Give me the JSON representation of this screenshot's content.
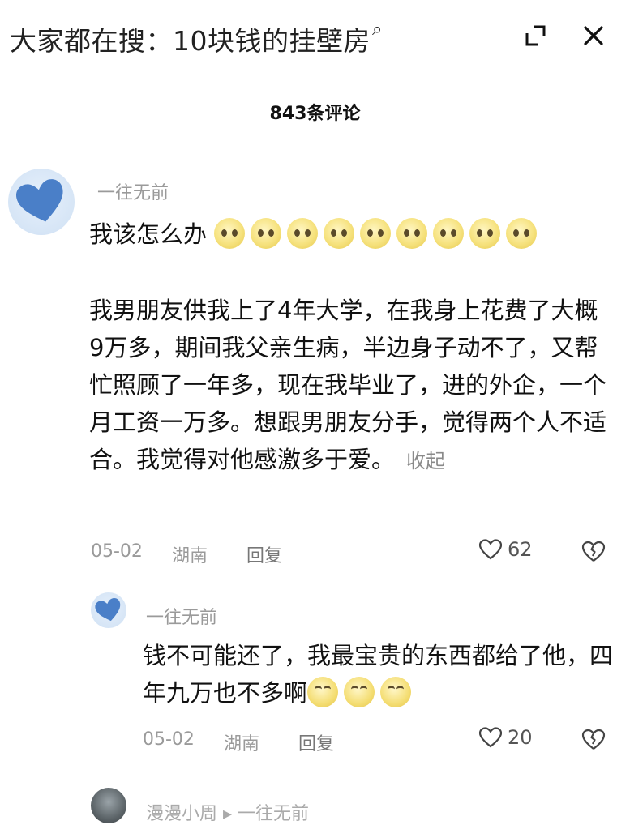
{
  "header": {
    "search_hint": "大家都在搜：10块钱的挂壁房",
    "comment_count": "843条评论"
  },
  "comments": [
    {
      "username": "一往无前",
      "first_line": "我该怎么办",
      "body": "我男朋友供我上了4年大学，在我身上花费了大概9万多，期间我父亲生病，半边身子动不了，又帮忙照顾了一年多，现在我毕业了，进的外企，一个月工资一万多。想跟男朋友分手，觉得两个人不适合。我觉得对他感激多于爱。",
      "expand_label": "收起",
      "date": "05-02",
      "location": "湖南",
      "reply_label": "回复",
      "likes": "62"
    },
    {
      "username": "一往无前",
      "body": "钱不可能还了，我最宝贵的东西都给了他，四年九万也不多啊",
      "date": "05-02",
      "location": "湖南",
      "reply_label": "回复",
      "likes": "20"
    },
    {
      "username": "漫漫小周 ▸ 一往无前"
    }
  ],
  "icons": {
    "search": "search-icon",
    "fullscreen": "fullscreen-icon",
    "close": "close-icon",
    "like": "heart-icon",
    "dislike": "broken-heart-icon",
    "emoji_sad": "sad-face-emoji",
    "emoji_happy": "happy-face-emoji"
  },
  "colors": {
    "avatar_heart": "#4a7fc8",
    "meta_text": "#9a9a9a",
    "emoji_yellow": "#f6e27e"
  }
}
